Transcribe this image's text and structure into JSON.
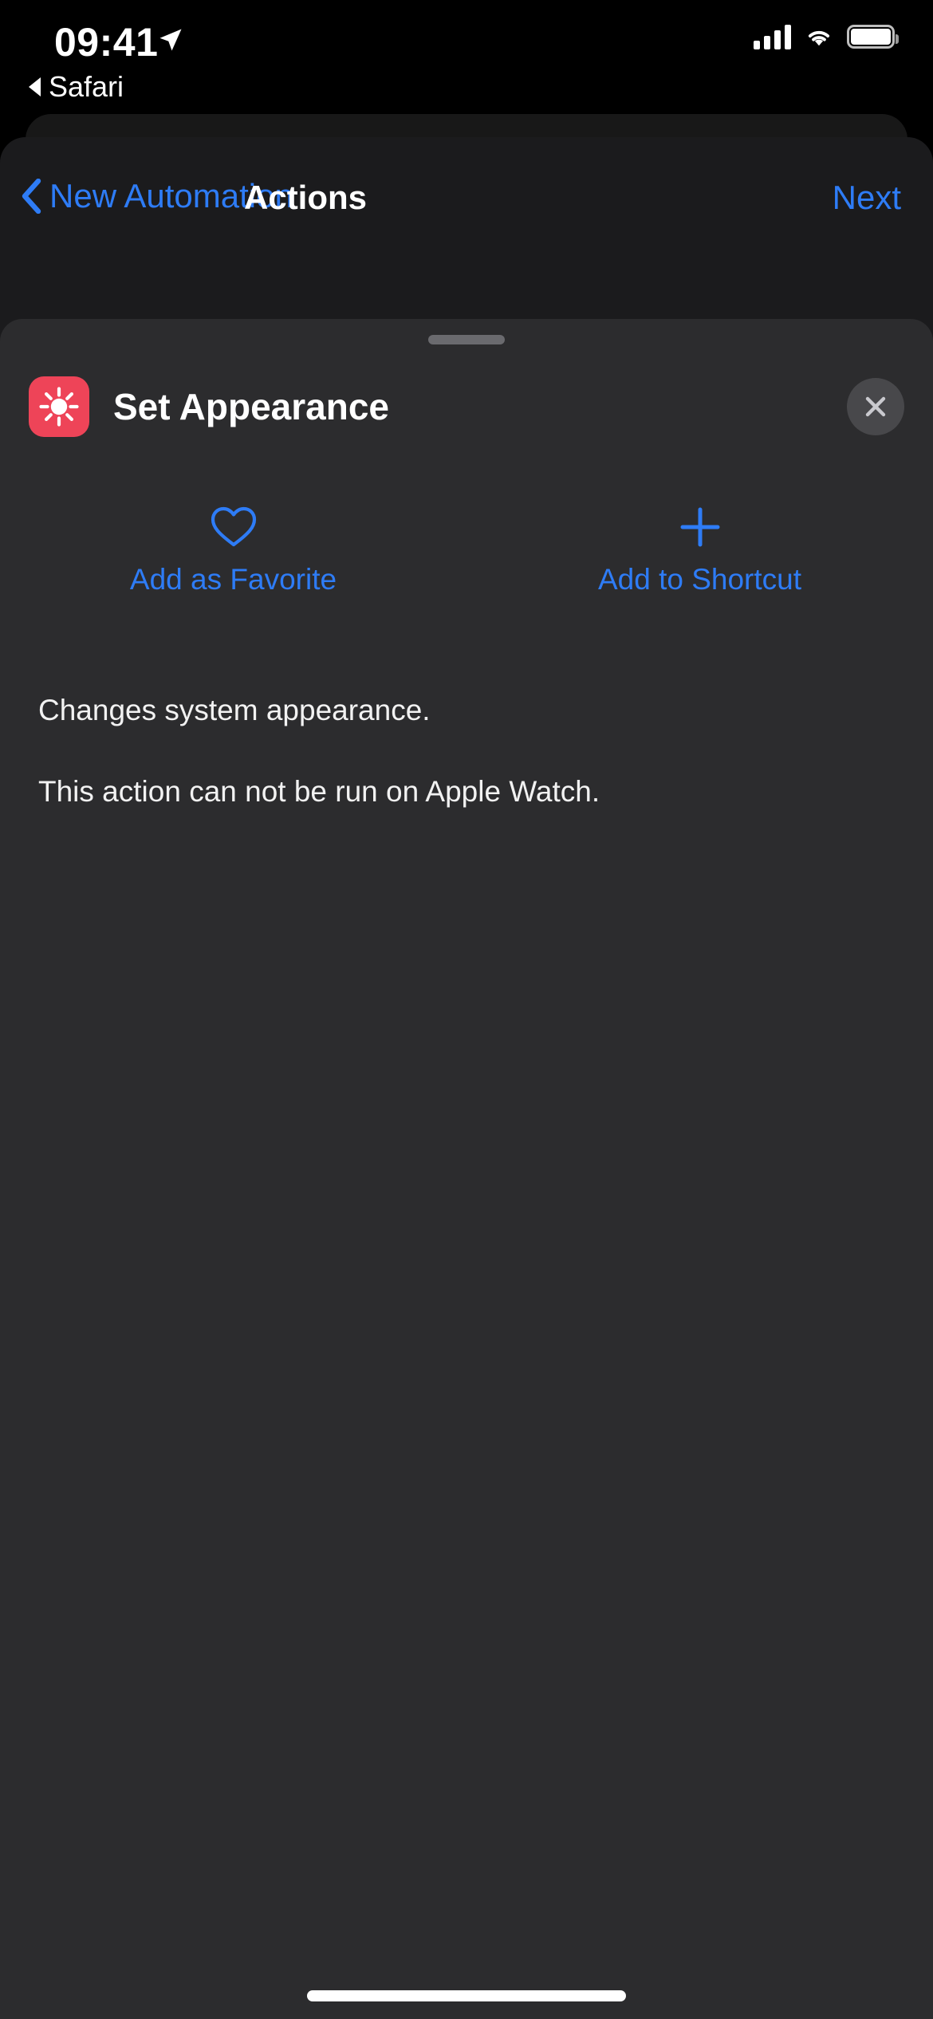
{
  "status_bar": {
    "time": "09:41",
    "location_icon": "location-arrow-icon",
    "signal_icon": "cellular-signal-icon",
    "wifi_icon": "wifi-icon",
    "battery_icon": "battery-full-icon"
  },
  "back_to_app": {
    "arrow_icon": "back-triangle-icon",
    "app_name": "Safari"
  },
  "navbar": {
    "back_icon": "chevron-left-icon",
    "back_label": "New Automation",
    "title": "Actions",
    "next_label": "Next"
  },
  "sheet": {
    "grabber": "sheet-grabber-handle",
    "app_icon": "sun-brightness-icon",
    "app_icon_color": "#EE4458",
    "title": "Set Appearance",
    "close_icon": "close-x-icon",
    "actions": [
      {
        "icon": "heart-outline-icon",
        "label": "Add as Favorite"
      },
      {
        "icon": "plus-icon",
        "label": "Add to Shortcut"
      }
    ],
    "description": [
      "Changes system appearance.",
      "This action can not be run on Apple Watch."
    ]
  },
  "colors": {
    "accent_blue": "#2E7CF6",
    "sheet_background": "#2C2C2E",
    "page_background": "#000000"
  },
  "home_indicator": "home-indicator"
}
